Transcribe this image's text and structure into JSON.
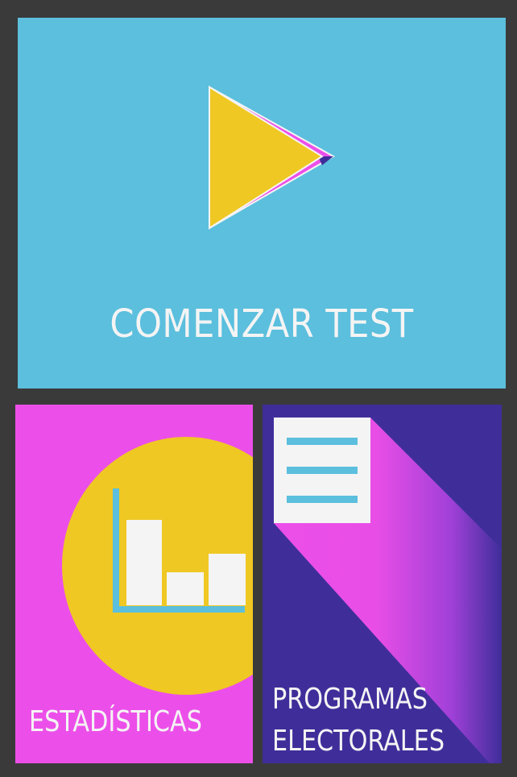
{
  "tiles": {
    "start": {
      "label": "COMENZAR TEST",
      "icon": "play-icon",
      "color": "#5bbfdd"
    },
    "stats": {
      "label": "ESTADÍSTICAS",
      "icon": "bar-chart-icon",
      "color": "#ec4fe9"
    },
    "programs": {
      "label_line1": "PROGRAMAS",
      "label_line2": "ELECTORALES",
      "icon": "document-icon",
      "color": "#3f2e9a"
    }
  },
  "colors": {
    "background": "#3a3a3a",
    "yellow": "#efc823",
    "magenta": "#ec4fe9",
    "blue": "#5bbfdd",
    "purple": "#3f2e9a",
    "white": "#f4f4f4"
  }
}
